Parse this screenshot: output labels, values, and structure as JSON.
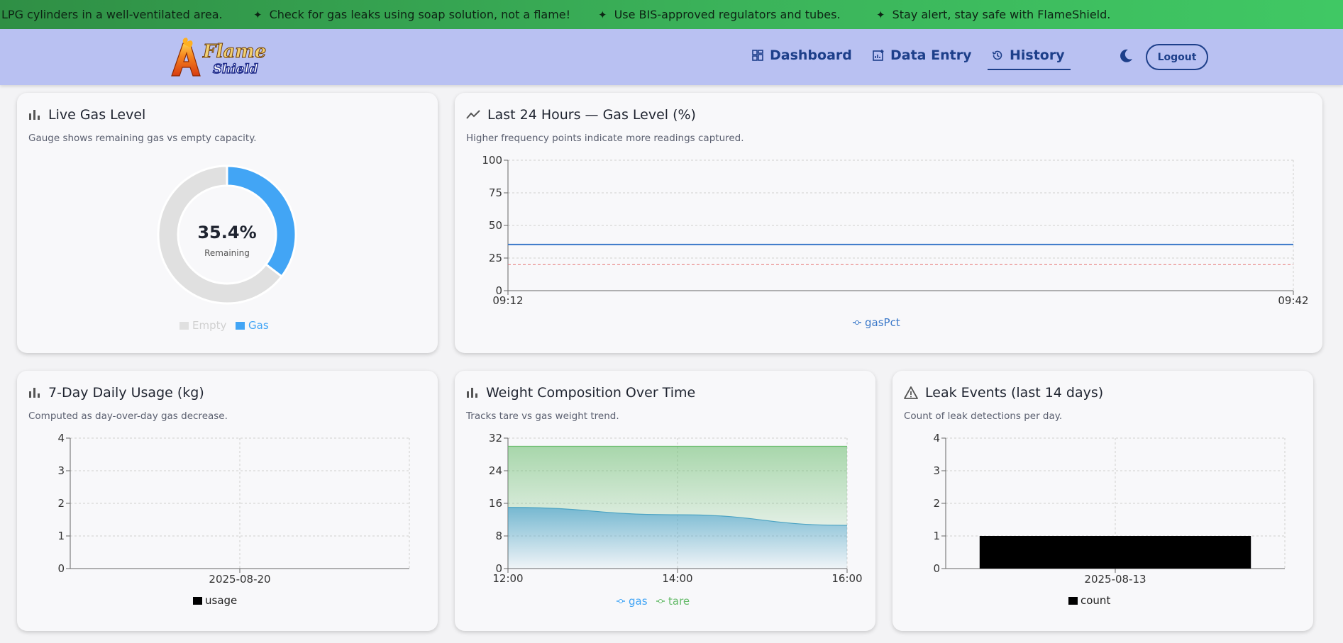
{
  "ticker": {
    "items": [
      "LPG cylinders in a well-ventilated area.",
      "Check for gas leaks using soap solution, not a flame!",
      "Use BIS-approved regulators and tubes.",
      "Stay alert, stay safe with FlameShield."
    ]
  },
  "header": {
    "logo_top": "Flame",
    "logo_bottom": "Shield",
    "nav": [
      {
        "label": "Dashboard",
        "icon": "dashboard-icon"
      },
      {
        "label": "Data Entry",
        "icon": "chart-add-icon"
      },
      {
        "label": "History",
        "icon": "history-icon",
        "active": true
      }
    ],
    "theme_icon": "moon-icon",
    "logout_label": "Logout"
  },
  "cards": {
    "live": {
      "title": "Live Gas Level",
      "subtitle": "Gauge shows remaining gas vs empty capacity.",
      "center_value": "35.4%",
      "center_label": "Remaining"
    },
    "last24": {
      "title": "Last 24 Hours — Gas Level (%)",
      "subtitle": "Higher frequency points indicate more readings captured."
    },
    "usage": {
      "title": "7-Day Daily Usage (kg)",
      "subtitle": "Computed as day-over-day gas decrease."
    },
    "weight": {
      "title": "Weight Composition Over Time",
      "subtitle": "Tracks tare vs gas weight trend."
    },
    "leak": {
      "title": "Leak Events (last 14 days)",
      "subtitle": "Count of leak detections per day."
    }
  },
  "colors": {
    "gas": "#42a5f5",
    "empty": "#e0e0e0",
    "line": "#3a78c9",
    "threshold": "#e57373",
    "tare": "#66bb6a",
    "gas_area": "#4ba3c3",
    "bar": "#000000"
  },
  "chart_data": [
    {
      "type": "pie",
      "categories": [
        "Empty",
        "Gas"
      ],
      "values": [
        64.6,
        35.4
      ],
      "legend": [
        "Empty",
        "Gas"
      ]
    },
    {
      "type": "line",
      "x": [
        "09:12",
        "09:42"
      ],
      "series": [
        {
          "name": "gasPct",
          "values": [
            35.4,
            35.4
          ]
        }
      ],
      "threshold": 20,
      "yticks": [
        "0",
        "25",
        "50",
        "75",
        "100"
      ],
      "ylim": [
        0,
        100
      ]
    },
    {
      "type": "bar",
      "categories": [
        "2025-08-20"
      ],
      "series": [
        {
          "name": "usage",
          "values": [
            0
          ]
        }
      ],
      "yticks": [
        "0",
        "1",
        "2",
        "3",
        "4"
      ],
      "ylim": [
        0,
        4
      ]
    },
    {
      "type": "area",
      "x": [
        "12:00",
        "14:00",
        "16:00"
      ],
      "series": [
        {
          "name": "gas",
          "values": [
            15,
            13.2,
            10.6
          ]
        },
        {
          "name": "tare",
          "values": [
            15,
            16.8,
            19.4
          ]
        }
      ],
      "yticks": [
        "0",
        "8",
        "16",
        "24",
        "32"
      ],
      "ylim": [
        0,
        32
      ]
    },
    {
      "type": "bar",
      "categories": [
        "2025-08-13"
      ],
      "series": [
        {
          "name": "count",
          "values": [
            1
          ]
        }
      ],
      "yticks": [
        "0",
        "1",
        "2",
        "3",
        "4"
      ],
      "ylim": [
        0,
        4
      ]
    }
  ]
}
